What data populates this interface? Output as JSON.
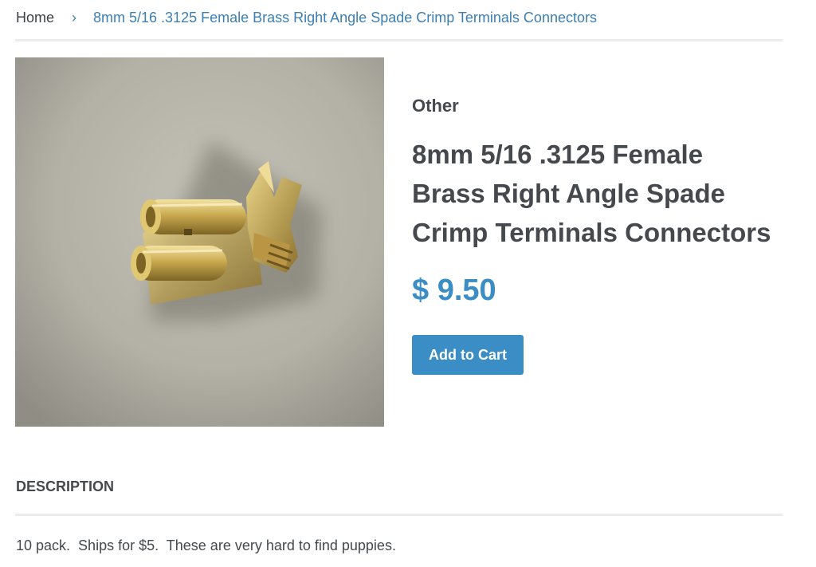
{
  "breadcrumb": {
    "home": "Home",
    "separator": "›",
    "current": "8mm 5/16 .3125 Female Brass Right Angle Spade Crimp Terminals Connectors"
  },
  "product": {
    "image_alt": "Brass right angle spade crimp terminal on grey background",
    "vendor": "Other",
    "title": "8mm 5/16 .3125 Female Brass Right Angle Spade Crimp Terminals Connectors",
    "price": "$ 9.50",
    "add_to_cart_label": "Add to Cart"
  },
  "description": {
    "heading": "DESCRIPTION",
    "text": "10 pack.  Ships for $5.  These are very hard to find puppies."
  },
  "colors": {
    "accent": "#3a8dc5",
    "link": "#3d7fb2",
    "text": "#45494d",
    "divider": "#ececec"
  }
}
